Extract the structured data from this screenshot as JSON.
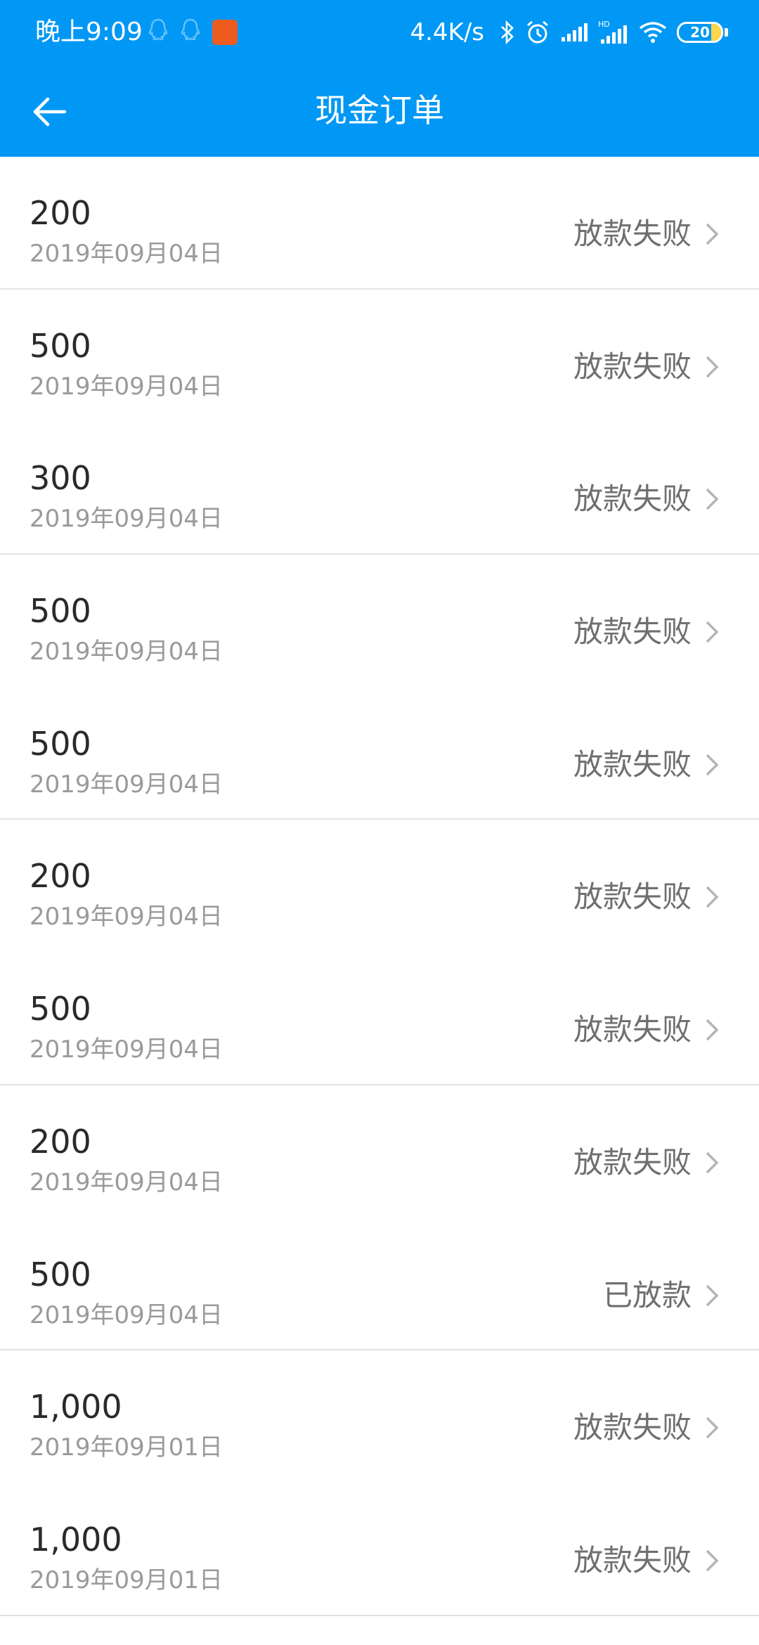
{
  "status_bar": {
    "time": "晚上9:09",
    "net_speed": "4.4K/s",
    "battery_level": "20",
    "icons": [
      "qq-icon",
      "qq-icon",
      "app-notification-icon",
      "bluetooth-icon",
      "alarm-icon",
      "signal-icon",
      "hd-signal-icon",
      "wifi-icon",
      "battery-icon"
    ]
  },
  "appbar": {
    "title": "现金订单",
    "back_icon": "arrow-left-icon"
  },
  "orders": [
    {
      "amount": "200",
      "date": "2019年09月04日",
      "status": "放款失败"
    },
    {
      "amount": "500",
      "date": "2019年09月04日",
      "status": "放款失败"
    },
    {
      "amount": "300",
      "date": "2019年09月04日",
      "status": "放款失败"
    },
    {
      "amount": "500",
      "date": "2019年09月04日",
      "status": "放款失败"
    },
    {
      "amount": "500",
      "date": "2019年09月04日",
      "status": "放款失败"
    },
    {
      "amount": "200",
      "date": "2019年09月04日",
      "status": "放款失败"
    },
    {
      "amount": "500",
      "date": "2019年09月04日",
      "status": "放款失败"
    },
    {
      "amount": "200",
      "date": "2019年09月04日",
      "status": "放款失败"
    },
    {
      "amount": "500",
      "date": "2019年09月04日",
      "status": "已放款"
    },
    {
      "amount": "1,000",
      "date": "2019年09月01日",
      "status": "放款失败"
    },
    {
      "amount": "1,000",
      "date": "2019年09月01日",
      "status": "放款失败"
    }
  ],
  "colors": {
    "header": "#0098f4",
    "amount_text": "#2a2a2a",
    "date_text": "#9a9a9a",
    "status_text": "#6f6f6f",
    "divider": "#e3e3e3"
  }
}
